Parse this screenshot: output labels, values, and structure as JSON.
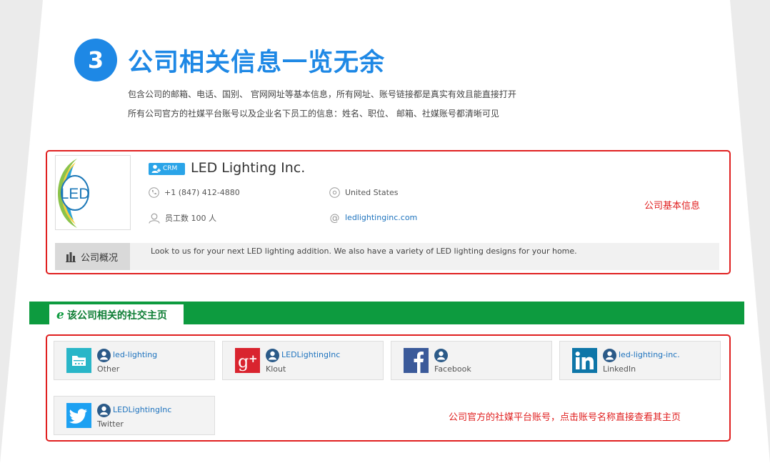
{
  "header": {
    "step_number": "3",
    "title": "公司相关信息一览无余",
    "desc_line1": "包含公司的邮箱、电话、国别、 官网网址等基本信息，所有网址、账号链接都是真实有效且能直接打开",
    "desc_line2": "所有公司官方的社媒平台账号以及企业名下员工的信息：姓名、职位、 邮箱、社媒账号都清晰可见"
  },
  "company": {
    "crm_badge": "CRM",
    "name": "LED Lighting Inc.",
    "logo_text": "LED",
    "phone": "+1 (847) 412-4880",
    "country": "United States",
    "employees": "员工数 100 人",
    "website": "ledlightinginc.com",
    "overview_tab": "公司概况",
    "overview_text": "Look to us for your next LED lighting addition. We also have a variety of LED lighting designs for your home.",
    "annotation": "公司基本信息"
  },
  "social": {
    "section_title": "该公司相关的社交主页",
    "annotation": "公司官方的社媒平台账号，点击账号名称直接查看其主页",
    "cards": [
      {
        "handle": "led-lighting",
        "platform": "Other",
        "icon": "folder-icon",
        "color": "#29b6c8"
      },
      {
        "handle": "LEDLightingInc",
        "platform": "Klout",
        "icon": "google-plus-icon",
        "color": "#d9242f"
      },
      {
        "handle": "",
        "platform": "Facebook",
        "icon": "facebook-icon",
        "color": "#3b5a9a"
      },
      {
        "handle": "led-lighting-inc.",
        "platform": "LinkedIn",
        "icon": "linkedin-icon",
        "color": "#0e76a8"
      },
      {
        "handle": "LEDLightingInc",
        "platform": "Twitter",
        "icon": "twitter-icon",
        "color": "#1da1f2"
      }
    ]
  },
  "colors": {
    "accent_blue": "#1e88e5",
    "annotation_red": "#e02020",
    "section_green": "#0d9b3f"
  }
}
